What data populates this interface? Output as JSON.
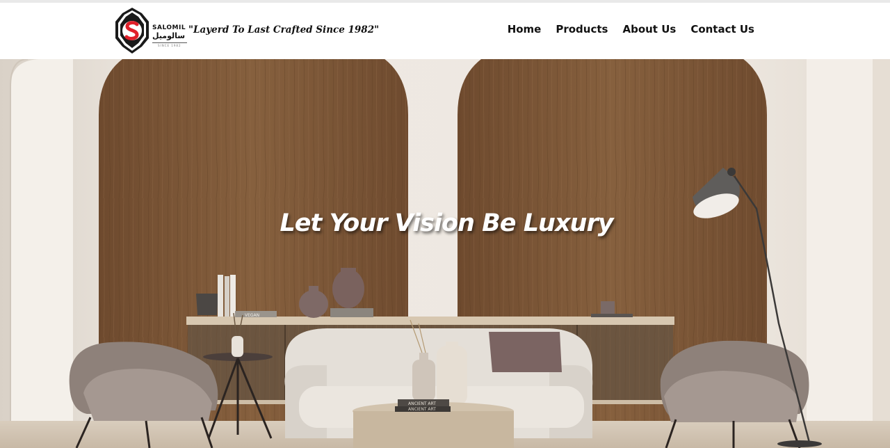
{
  "brand": {
    "name_en": "SALOMIL",
    "name_ar": "سالوميل",
    "since": "SINCE 1982",
    "logo_icon": "salomil-s-emblem",
    "tagline": "\"Layerd To Last Crafted Since 1982\""
  },
  "nav": {
    "items": [
      {
        "label": "Home"
      },
      {
        "label": "Products"
      },
      {
        "label": "About Us"
      },
      {
        "label": "Contact Us"
      }
    ]
  },
  "hero": {
    "title": "Let Your Vision Be Luxury",
    "book_labels": {
      "vegan": "VEGAN",
      "ancient_art_top": "ANCIENT ART",
      "ancient_art_bottom": "ANCIENT ART"
    }
  },
  "colors": {
    "logo_red": "#e0202a",
    "logo_black": "#1a1a1a",
    "wood": "#7a5535",
    "wall": "#ece6df"
  }
}
